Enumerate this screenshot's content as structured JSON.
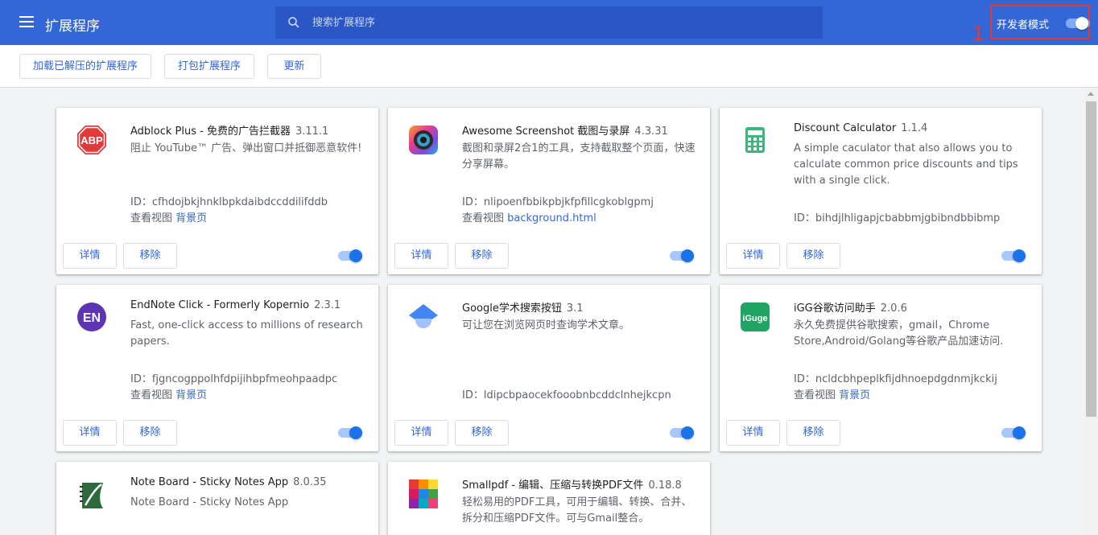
{
  "header": {
    "title": "扩展程序",
    "search_placeholder": "搜索扩展程序",
    "dev_mode_label": "开发者模式",
    "annotation": "1"
  },
  "toolbar": {
    "load_unpacked": "加载已解压的扩展程序",
    "pack": "打包扩展程序",
    "update": "更新"
  },
  "labels": {
    "details": "详情",
    "remove": "移除",
    "id_prefix": "ID：",
    "inspect_views": "查看视图"
  },
  "extensions": [
    {
      "name": "Adblock Plus - 免费的广告拦截器",
      "version": "3.11.1",
      "desc": "阻止 YouTube™ 广告、弹出窗口并抵御恶意软件!",
      "id": "cfhdojbkjhnklbpkdaibdccddilifddb",
      "view_link": "背景页",
      "enabled": true,
      "icon": "abp-stop-icon"
    },
    {
      "name": "Awesome Screenshot 截图与录屏",
      "version": "4.3.31",
      "desc": "截图和录屏2合1的工具，支持截取整个页面，快速分享屏幕。",
      "id": "nlipoenfbbikpbjkfpfillcgkoblgpmj",
      "view_link": "background.html",
      "enabled": true,
      "icon": "camera-lens-icon"
    },
    {
      "name": "Discount Calculator",
      "version": "1.1.4",
      "desc": "A simple caculator that also allows you to calculate common price discounts and tips with a single click.",
      "id": "bihdjlhligapjcbabbmjgbibndbbibmp",
      "view_link": "",
      "enabled": true,
      "icon": "calculator-icon"
    },
    {
      "name": "EndNote Click - Formerly Kopernio",
      "version": "2.3.1",
      "desc": "Fast, one-click access to millions of research papers.",
      "id": "fjgncogppolhfdpijihbpfmeohpaadpc",
      "view_link": "背景页",
      "enabled": true,
      "icon": "endnote-icon",
      "icon_text": "EN"
    },
    {
      "name": "Google学术搜索按钮",
      "version": "3.1",
      "desc": "可让您在浏览网页时查询学术文章。",
      "id": "ldipcbpaocekfooobnbcddclnhejkcpn",
      "view_link": "",
      "enabled": true,
      "icon": "scholar-cap-icon"
    },
    {
      "name": "iGG谷歌访问助手",
      "version": "2.0.6",
      "desc": "永久免费提供谷歌搜索，gmail，Chrome Store,Android/Golang等谷歌产品加速访问.",
      "id": "ncldcbhpeplkfijdhnoepdgdnmjkckij",
      "view_link": "背景页",
      "enabled": true,
      "icon": "iguge-icon",
      "icon_text": "iGuge"
    },
    {
      "name": "Note Board - Sticky Notes App",
      "version": "8.0.35",
      "desc": "Note Board - Sticky Notes App",
      "id": "",
      "view_link": "",
      "enabled": true,
      "icon": "noteboard-icon"
    },
    {
      "name": "Smallpdf - 编辑、压缩与转换PDF文件",
      "version": "0.18.8",
      "desc": "轻松易用的PDF工具，可用于编辑、转换、合并、拆分和压缩PDF文件。可与Gmail整合。",
      "id": "",
      "view_link": "",
      "enabled": true,
      "icon": "smallpdf-grid-icon"
    }
  ],
  "colors": {
    "header_bg": "#3367d6",
    "accent": "#1a73e8",
    "annotation": "#e53935"
  }
}
